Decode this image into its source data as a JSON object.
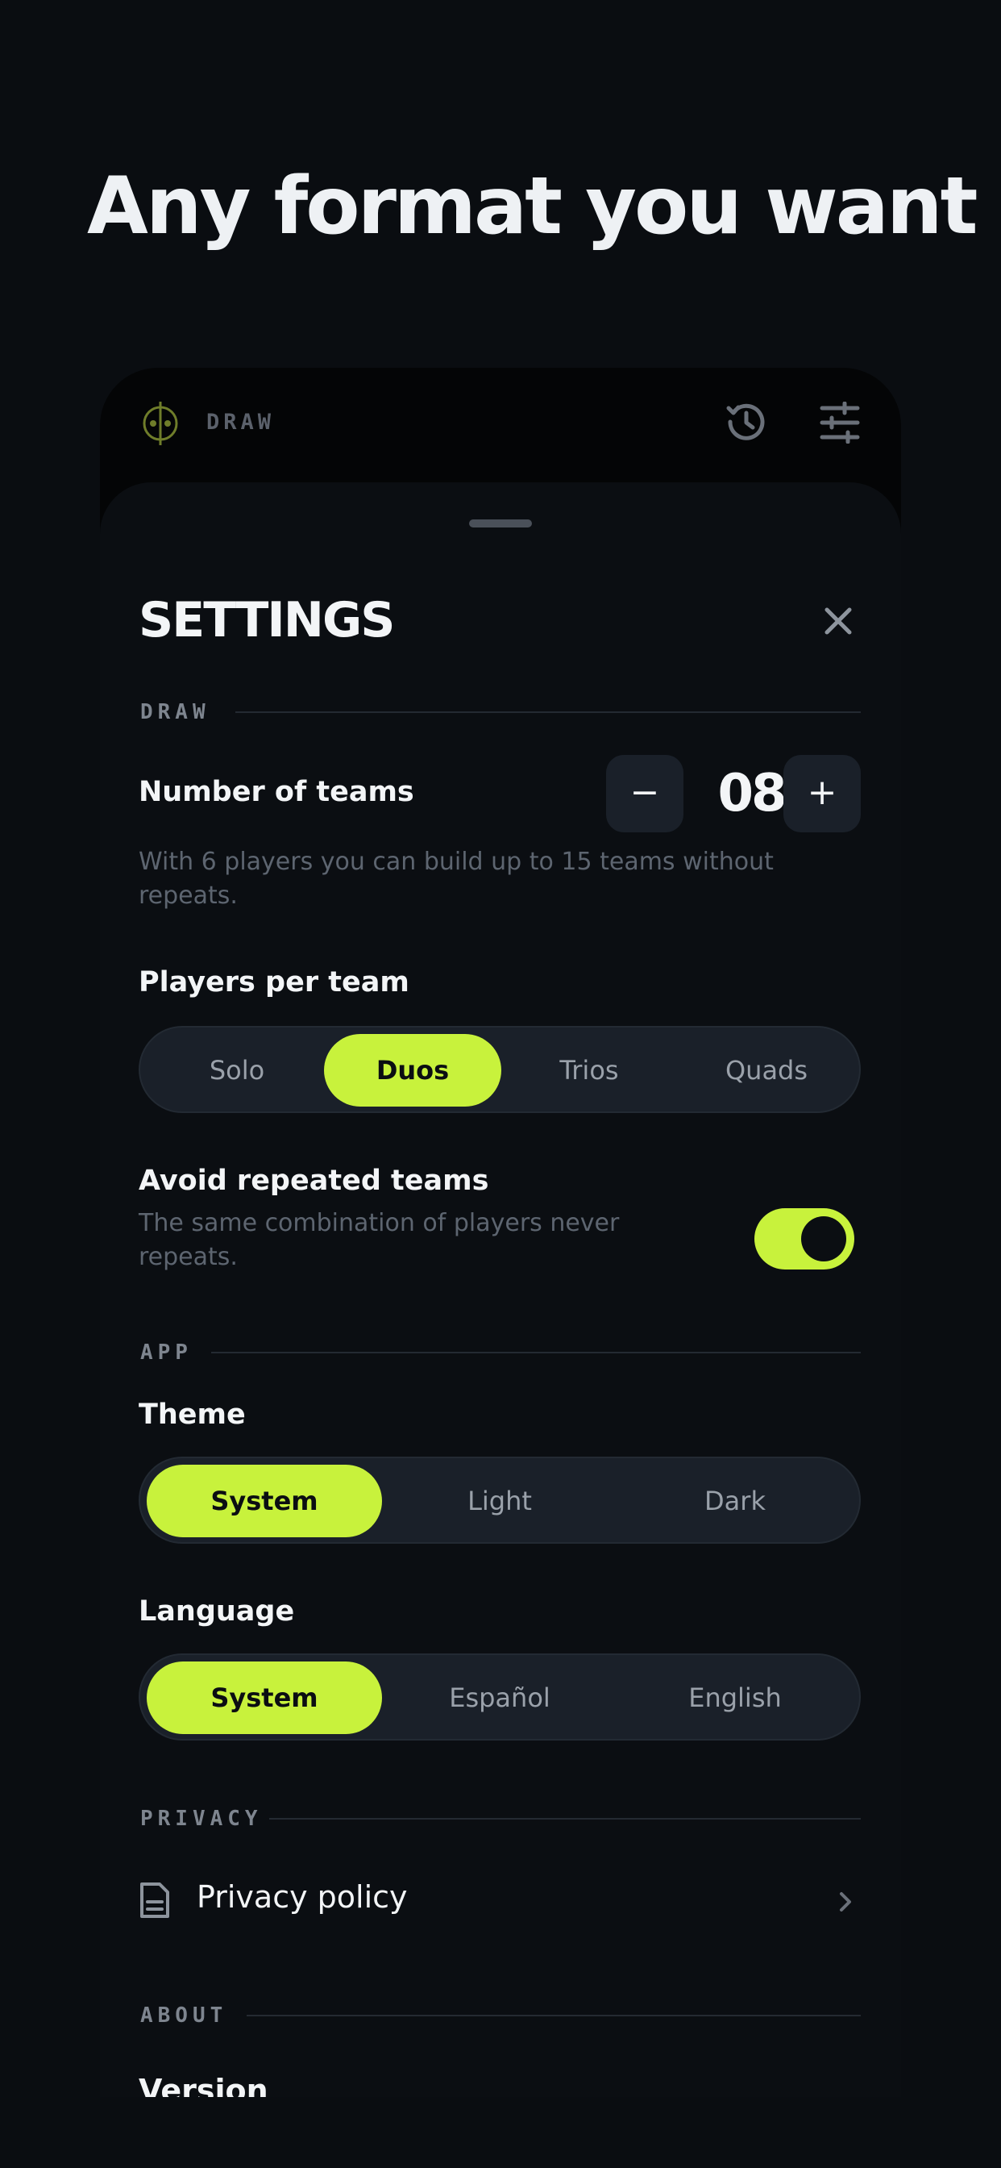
{
  "headline": "Any format you want",
  "app_bar": {
    "title": "DRAW",
    "logo_icon": "ball-icon",
    "history_icon": "history-icon",
    "settings_icon": "tune-icon"
  },
  "settings": {
    "title": "SETTINGS",
    "close_icon": "close-icon",
    "sections": {
      "draw": "DRAW",
      "app": "APP",
      "privacy": "PRIVACY",
      "about": "ABOUT"
    },
    "number_of_teams": {
      "label": "Number of teams",
      "value": "08",
      "decrement": "−",
      "increment": "+",
      "hint": "With 6 players you can build up to 15 teams without repeats."
    },
    "players_per_team": {
      "label": "Players per team",
      "options": [
        "Solo",
        "Duos",
        "Trios",
        "Quads"
      ],
      "selected": "Duos"
    },
    "avoid_repeated": {
      "label": "Avoid repeated teams",
      "hint": "The same combination of players never repeats.",
      "enabled": true
    },
    "theme": {
      "label": "Theme",
      "options": [
        "System",
        "Light",
        "Dark"
      ],
      "selected": "System"
    },
    "language": {
      "label": "Language",
      "options": [
        "System",
        "Español",
        "English"
      ],
      "selected": "System"
    },
    "privacy_policy": {
      "label": "Privacy policy",
      "icon": "document-icon",
      "chevron": "chevron-right-icon"
    },
    "version": {
      "label": "Version"
    }
  },
  "colors": {
    "accent": "#c8f23c",
    "background": "#0a0d11",
    "surface": "#1a2029"
  }
}
